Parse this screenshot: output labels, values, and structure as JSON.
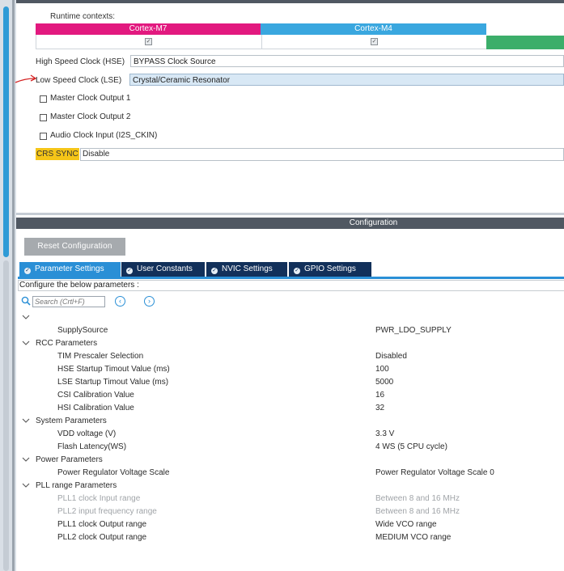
{
  "mode": {
    "runtime_contexts_label": "Runtime contexts:",
    "contexts": [
      {
        "label": "Cortex-M7",
        "color": "#e2197f",
        "checked": true
      },
      {
        "label": "Cortex-M4",
        "color": "#3aa7df",
        "checked": true
      },
      {
        "label": "",
        "color": "#3cae6a"
      }
    ],
    "hse": {
      "label": "High Speed Clock (HSE)",
      "value": "BYPASS Clock Source"
    },
    "lse": {
      "label": "Low Speed Clock (LSE)",
      "value": "Crystal/Ceramic Resonator"
    },
    "options": [
      {
        "label": "Master Clock Output 1",
        "checked": false
      },
      {
        "label": "Master Clock Output 2",
        "checked": false
      },
      {
        "label": "Audio Clock Input (I2S_CKIN)",
        "checked": false
      }
    ],
    "crs": {
      "label": "CRS SYNC",
      "value": "Disable"
    }
  },
  "config": {
    "header": "Configuration",
    "reset_label": "Reset Configuration",
    "tabs": [
      {
        "label": "Parameter Settings",
        "active": true
      },
      {
        "label": "User Constants"
      },
      {
        "label": "NVIC Settings"
      },
      {
        "label": "GPIO Settings"
      }
    ],
    "configure_text": "Configure the below parameters :",
    "search_placeholder": "Search (Crtl+F)",
    "groups": [
      {
        "name": "",
        "rows": [
          {
            "name": "SupplySource",
            "value": "PWR_LDO_SUPPLY"
          }
        ]
      },
      {
        "name": "RCC Parameters",
        "rows": [
          {
            "name": "TIM Prescaler Selection",
            "value": "Disabled"
          },
          {
            "name": "HSE Startup Timout Value (ms)",
            "value": "100"
          },
          {
            "name": "LSE Startup Timout Value (ms)",
            "value": "5000"
          },
          {
            "name": "CSI Calibration Value",
            "value": "16"
          },
          {
            "name": "HSI Calibration Value",
            "value": "32"
          }
        ]
      },
      {
        "name": "System Parameters",
        "rows": [
          {
            "name": "VDD voltage (V)",
            "value": "3.3 V"
          },
          {
            "name": "Flash Latency(WS)",
            "value": "4 WS (5 CPU cycle)"
          }
        ]
      },
      {
        "name": "Power Parameters",
        "rows": [
          {
            "name": "Power Regulator Voltage Scale",
            "value": "Power Regulator Voltage Scale 0"
          }
        ]
      },
      {
        "name": "PLL range Parameters",
        "rows": [
          {
            "name": "PLL1 clock Input range",
            "value": "Between 8 and 16 MHz",
            "disabled": true
          },
          {
            "name": "PLL2 input frequency range",
            "value": "Between 8 and 16 MHz",
            "disabled": true
          },
          {
            "name": "PLL1 clock Output range",
            "value": "Wide VCO range"
          },
          {
            "name": "PLL2 clock Output range",
            "value": "MEDIUM VCO range"
          }
        ]
      }
    ]
  }
}
